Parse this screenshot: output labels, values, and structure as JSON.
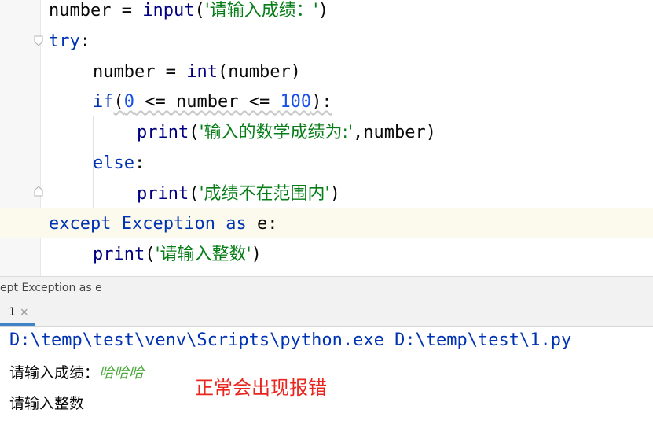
{
  "editor": {
    "lines": [
      {
        "pre": "number = ",
        "fn": "input",
        "lp": "(",
        "str": "'请输入成绩：'",
        "rp": ")"
      },
      {
        "kw": "try",
        "rest": ":"
      },
      {
        "a": "number = ",
        "fn": "int",
        "b": "(number)"
      },
      {
        "kw": "if",
        "open": "(",
        "n0": "0",
        "mid": " <= number <= ",
        "n1": "100",
        "close": "):"
      },
      {
        "fn": "print",
        "lp": "(",
        "str": "'输入的数学成绩为:'",
        "rest": ",number)"
      },
      {
        "kw": "else",
        "rest": ":"
      },
      {
        "fn": "print",
        "lp": "(",
        "str": "'成绩不在范围内'",
        "rp": ")"
      },
      {
        "kw": "except",
        "sp": " ",
        "cls": "Exception",
        "sp2": " ",
        "kw2": "as",
        "rest": " e:"
      },
      {
        "fn": "print",
        "lp": "(",
        "str": "'请输入整数'",
        "rp": ")"
      }
    ]
  },
  "breadcrumb": "ept Exception as e",
  "run_tab": {
    "label": "1",
    "close": "×"
  },
  "console": {
    "command": "D:\\temp\\test\\venv\\Scripts\\python.exe D:\\temp\\test\\1.py",
    "prompt": "请输入成绩：",
    "input_value": "哈哈哈",
    "output": "请输入整数"
  },
  "annotation": "正常会出现报错"
}
